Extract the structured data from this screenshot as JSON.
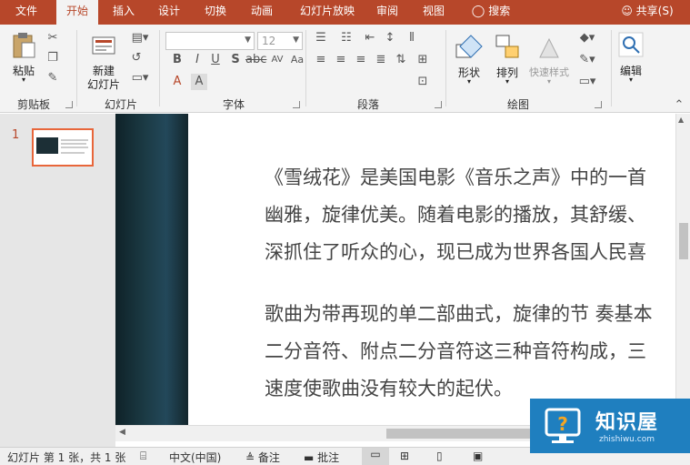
{
  "tabs": [
    {
      "label": "文件",
      "active": false
    },
    {
      "label": "开始",
      "active": true
    },
    {
      "label": "插入",
      "active": false
    },
    {
      "label": "设计",
      "active": false
    },
    {
      "label": "切换",
      "active": false
    },
    {
      "label": "动画",
      "active": false
    },
    {
      "label": "幻灯片放映",
      "active": false
    },
    {
      "label": "审阅",
      "active": false
    },
    {
      "label": "视图",
      "active": false
    }
  ],
  "search_label": "搜索",
  "share_label": "共享(S)",
  "ribbon": {
    "clipboard": {
      "paste": "粘贴",
      "group": "剪贴板"
    },
    "slides": {
      "new_slide_line1": "新建",
      "new_slide_line2": "幻灯片",
      "group": "幻灯片"
    },
    "font": {
      "name_value": "",
      "size_value": "12",
      "group": "字体",
      "bold": "B",
      "italic": "I",
      "underline": "U",
      "strike": "S",
      "spacing": "AV",
      "case": "Aa",
      "highlight": "A",
      "color": "A"
    },
    "paragraph": {
      "group": "段落"
    },
    "drawing": {
      "shape": "形状",
      "arrange": "排列",
      "quick_styles": "快速样式",
      "group": "绘图"
    },
    "editing": {
      "label": "编辑"
    }
  },
  "slide_number": "1",
  "slide_text": {
    "p1": [
      "《雪绒花》是美国电影《音乐之声》中的一首",
      "幽雅，旋律优美。随着电影的播放，其舒缓、",
      "深抓住了听众的心，现已成为世界各国人民喜"
    ],
    "p2": [
      "歌曲为带再现的单二部曲式，旋律的节 奏基本",
      "二分音符、附点二分音符这三种音符构成，三",
      "速度使歌曲没有较大的起伏。"
    ]
  },
  "status": {
    "slide_info": "幻灯片 第 1 张，共 1 张",
    "language": "中文(中国)",
    "notes": "备注",
    "comments": "批注"
  },
  "watermark": {
    "title": "知识屋",
    "url": "zhishiwu.com"
  },
  "colors": {
    "accent": "#b7472a",
    "thumb_border": "#e8663a",
    "text": "#444444",
    "watermark_bg": "#1f7fbf"
  }
}
